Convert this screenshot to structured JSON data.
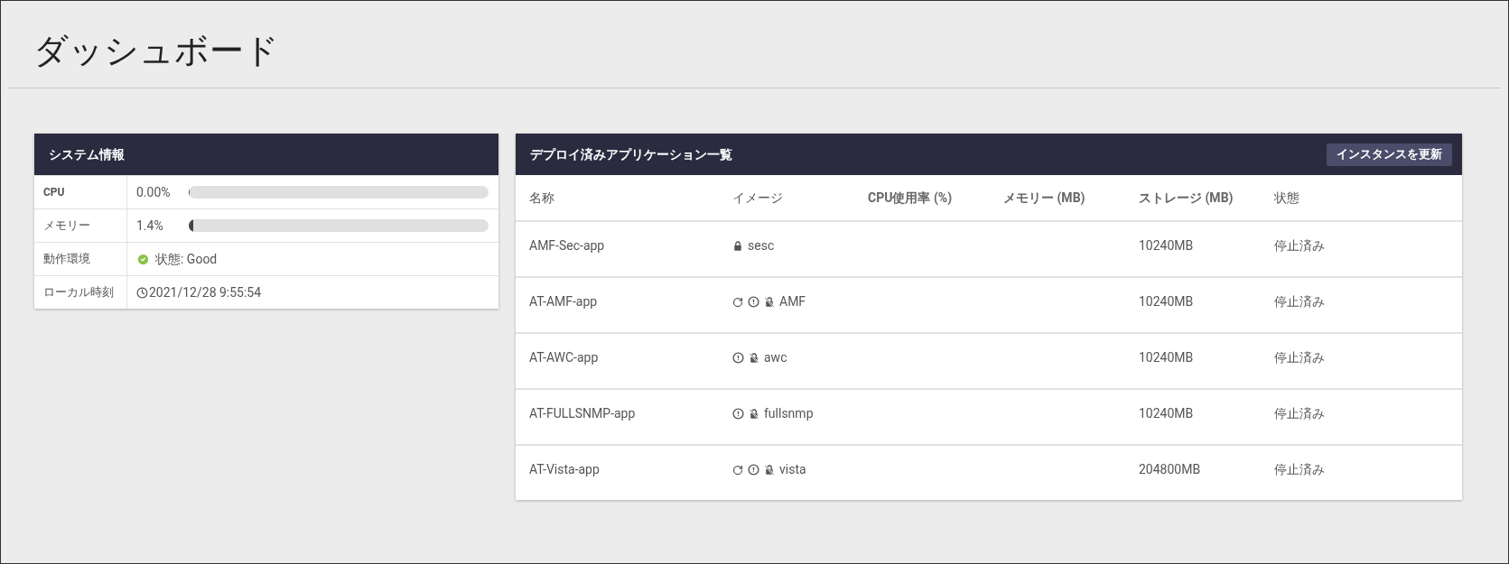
{
  "page_title": "ダッシュボード",
  "system_info": {
    "title": "システム情報",
    "rows": [
      {
        "kind": "meter",
        "label": "CPU",
        "reading": "0.00%",
        "level": 0
      },
      {
        "kind": "meter",
        "label": "メモリー",
        "reading": "1.4%",
        "level": 0.014
      },
      {
        "kind": "status",
        "label": "動作環境",
        "value": "状態: Good",
        "ok": true
      },
      {
        "kind": "clock",
        "label": "ローカル時刻",
        "value": "2021/12/28 9:55:54"
      }
    ]
  },
  "apps": {
    "title": "デプロイ済みアプリケーション一覧",
    "refresh_button": "インスタンスを更新",
    "columns": [
      "名称",
      "イメージ",
      "CPU使用率 (%)",
      "メモリー (MB)",
      "ストレージ (MB)",
      "状態"
    ],
    "rows": [
      {
        "name": "AMF-Sec-app",
        "image": "sesc",
        "update": false,
        "alert": false,
        "locked": true,
        "storage": "10240MB",
        "state": "停止済み"
      },
      {
        "name": "AT-AMF-app",
        "image": "AMF",
        "update": true,
        "alert": true,
        "locked": false,
        "storage": "10240MB",
        "state": "停止済み"
      },
      {
        "name": "AT-AWC-app",
        "image": "awc",
        "update": false,
        "alert": true,
        "locked": false,
        "storage": "10240MB",
        "state": "停止済み"
      },
      {
        "name": "AT-FULLSNMP-app",
        "image": "fullsnmp",
        "update": false,
        "alert": true,
        "locked": false,
        "storage": "10240MB",
        "state": "停止済み"
      },
      {
        "name": "AT-Vista-app",
        "image": "vista",
        "update": true,
        "alert": true,
        "locked": false,
        "storage": "204800MB",
        "state": "停止済み"
      }
    ]
  }
}
